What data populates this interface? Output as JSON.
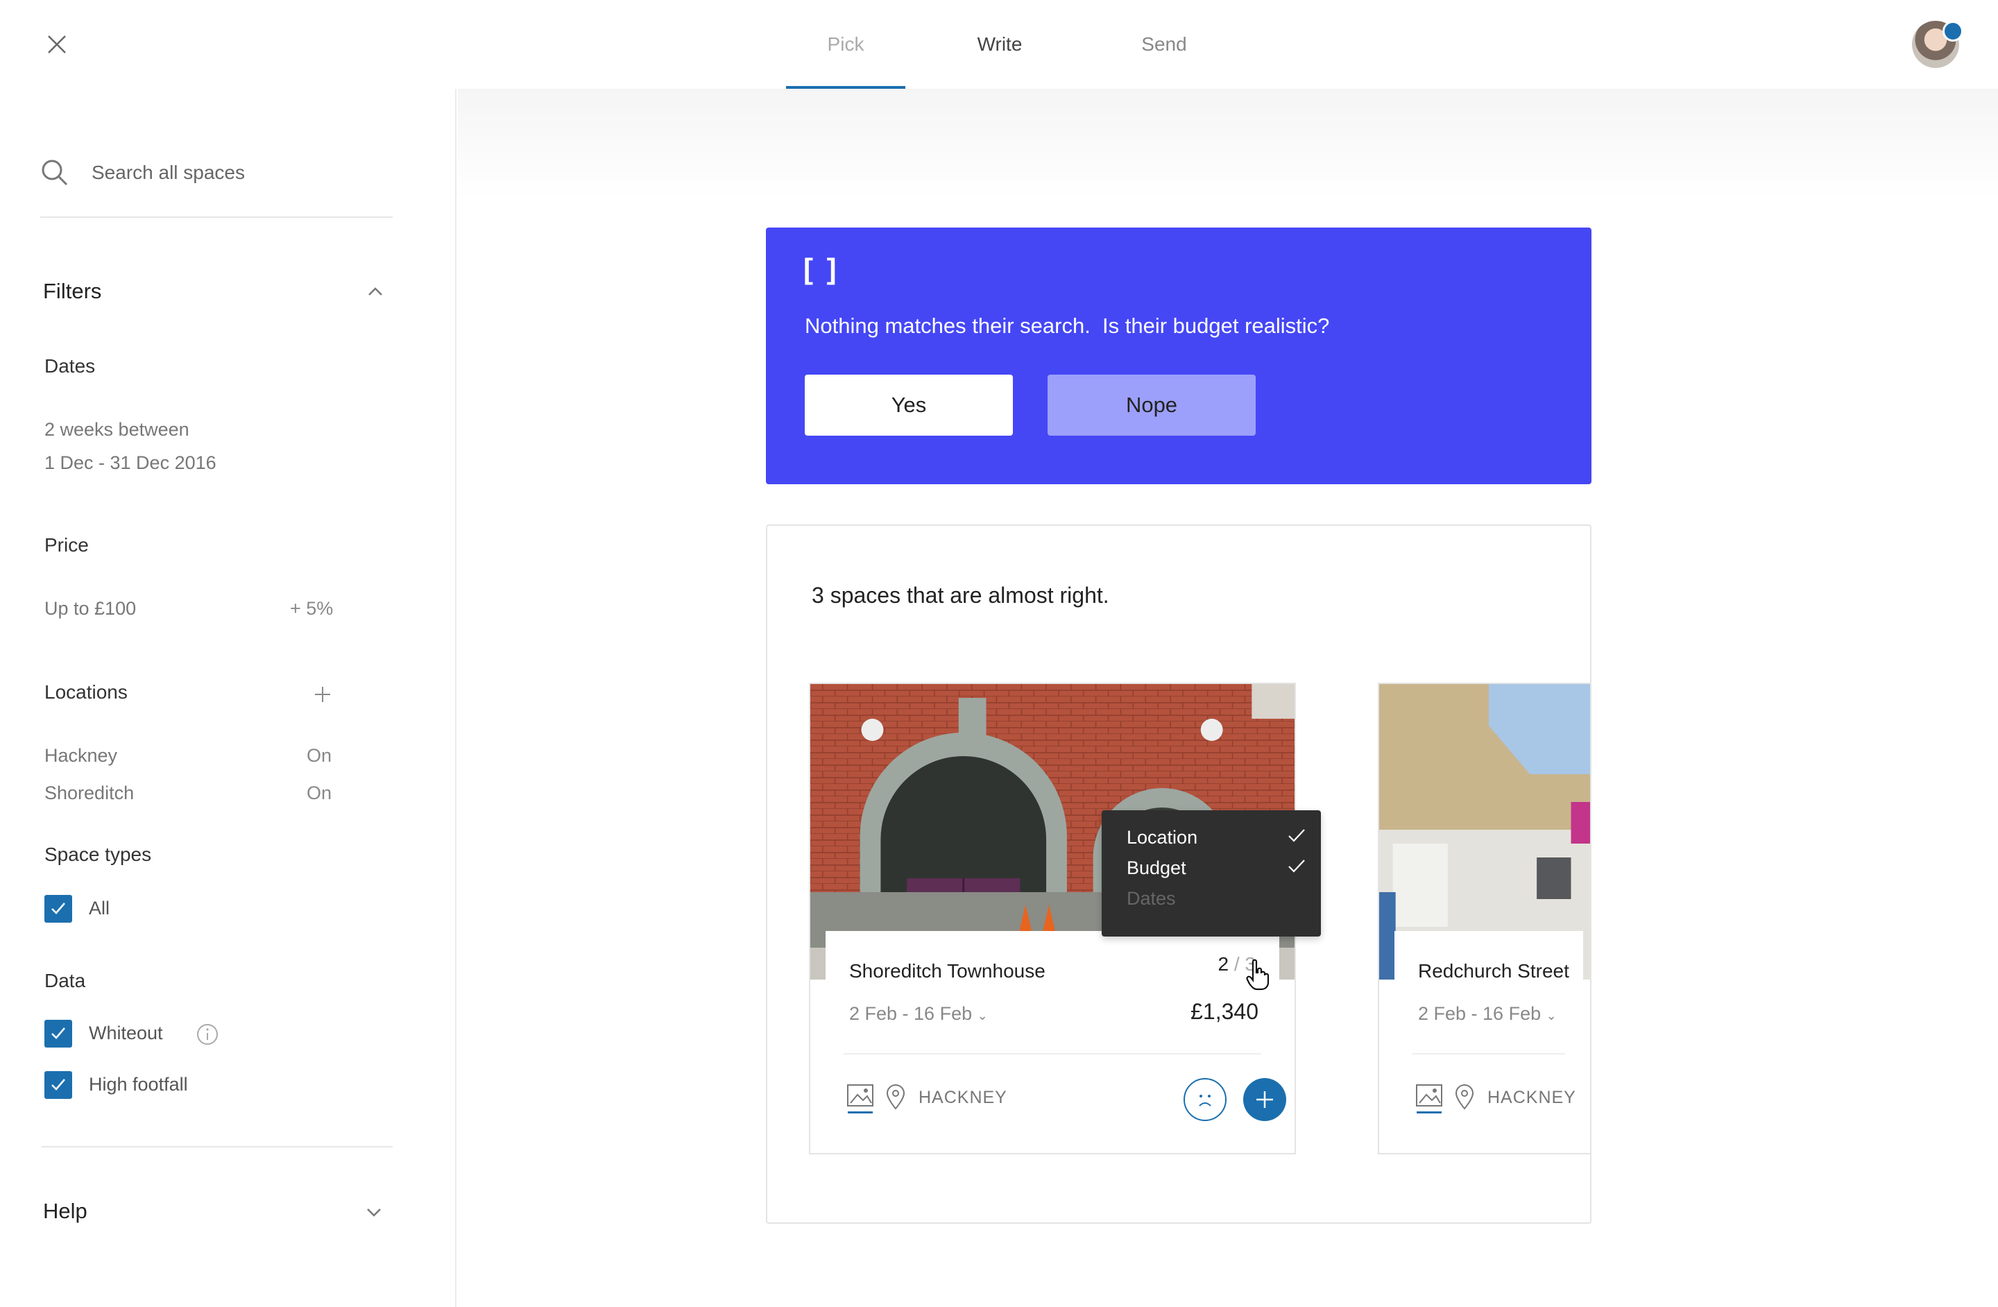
{
  "topbar": {
    "tabs": [
      {
        "label": "Pick"
      },
      {
        "label": "Write"
      },
      {
        "label": "Send"
      }
    ],
    "active_tab": "Pick"
  },
  "sidebar": {
    "search_placeholder": "Search all spaces",
    "filters_heading": "Filters",
    "dates_heading": "Dates",
    "dates_line1": "2 weeks between",
    "dates_line2": "1 Dec - 31 Dec 2016",
    "price_heading": "Price",
    "price_value": "Up to £100",
    "price_tolerance": "+ 5%",
    "locations_heading": "Locations",
    "locations": [
      {
        "name": "Hackney",
        "state": "On"
      },
      {
        "name": "Shoreditch",
        "state": "On"
      }
    ],
    "space_types_heading": "Space types",
    "space_types": [
      {
        "label": "All",
        "checked": true
      }
    ],
    "data_heading": "Data",
    "data_options": [
      {
        "label": "Whiteout",
        "checked": true
      },
      {
        "label": "High footfall",
        "checked": true
      }
    ],
    "help_heading": "Help"
  },
  "banner": {
    "brackets": "[ ]",
    "question": "Nothing matches their search.  Is their budget realistic?",
    "yes_label": "Yes",
    "nope_label": "Nope"
  },
  "results": {
    "title": "3 spaces that are almost right.",
    "cards": [
      {
        "name": "Shoreditch Townhouse",
        "dates": "2 Feb - 16 Feb",
        "price": "£1,340",
        "match_count": "2",
        "match_total": "3",
        "location": "HACKNEY"
      },
      {
        "name": "Redchurch Street",
        "dates": "2 Feb - 16 Feb",
        "location": "HACKNEY"
      }
    ]
  },
  "tooltip": {
    "items": [
      {
        "label": "Location",
        "matched": true
      },
      {
        "label": "Budget",
        "matched": true
      },
      {
        "label": "Dates",
        "matched": false
      }
    ]
  },
  "colors": {
    "accent": "#1b6fae",
    "banner": "#4547f5",
    "nope_button": "#9ca0fb",
    "tooltip_bg": "#2f2f2f"
  }
}
